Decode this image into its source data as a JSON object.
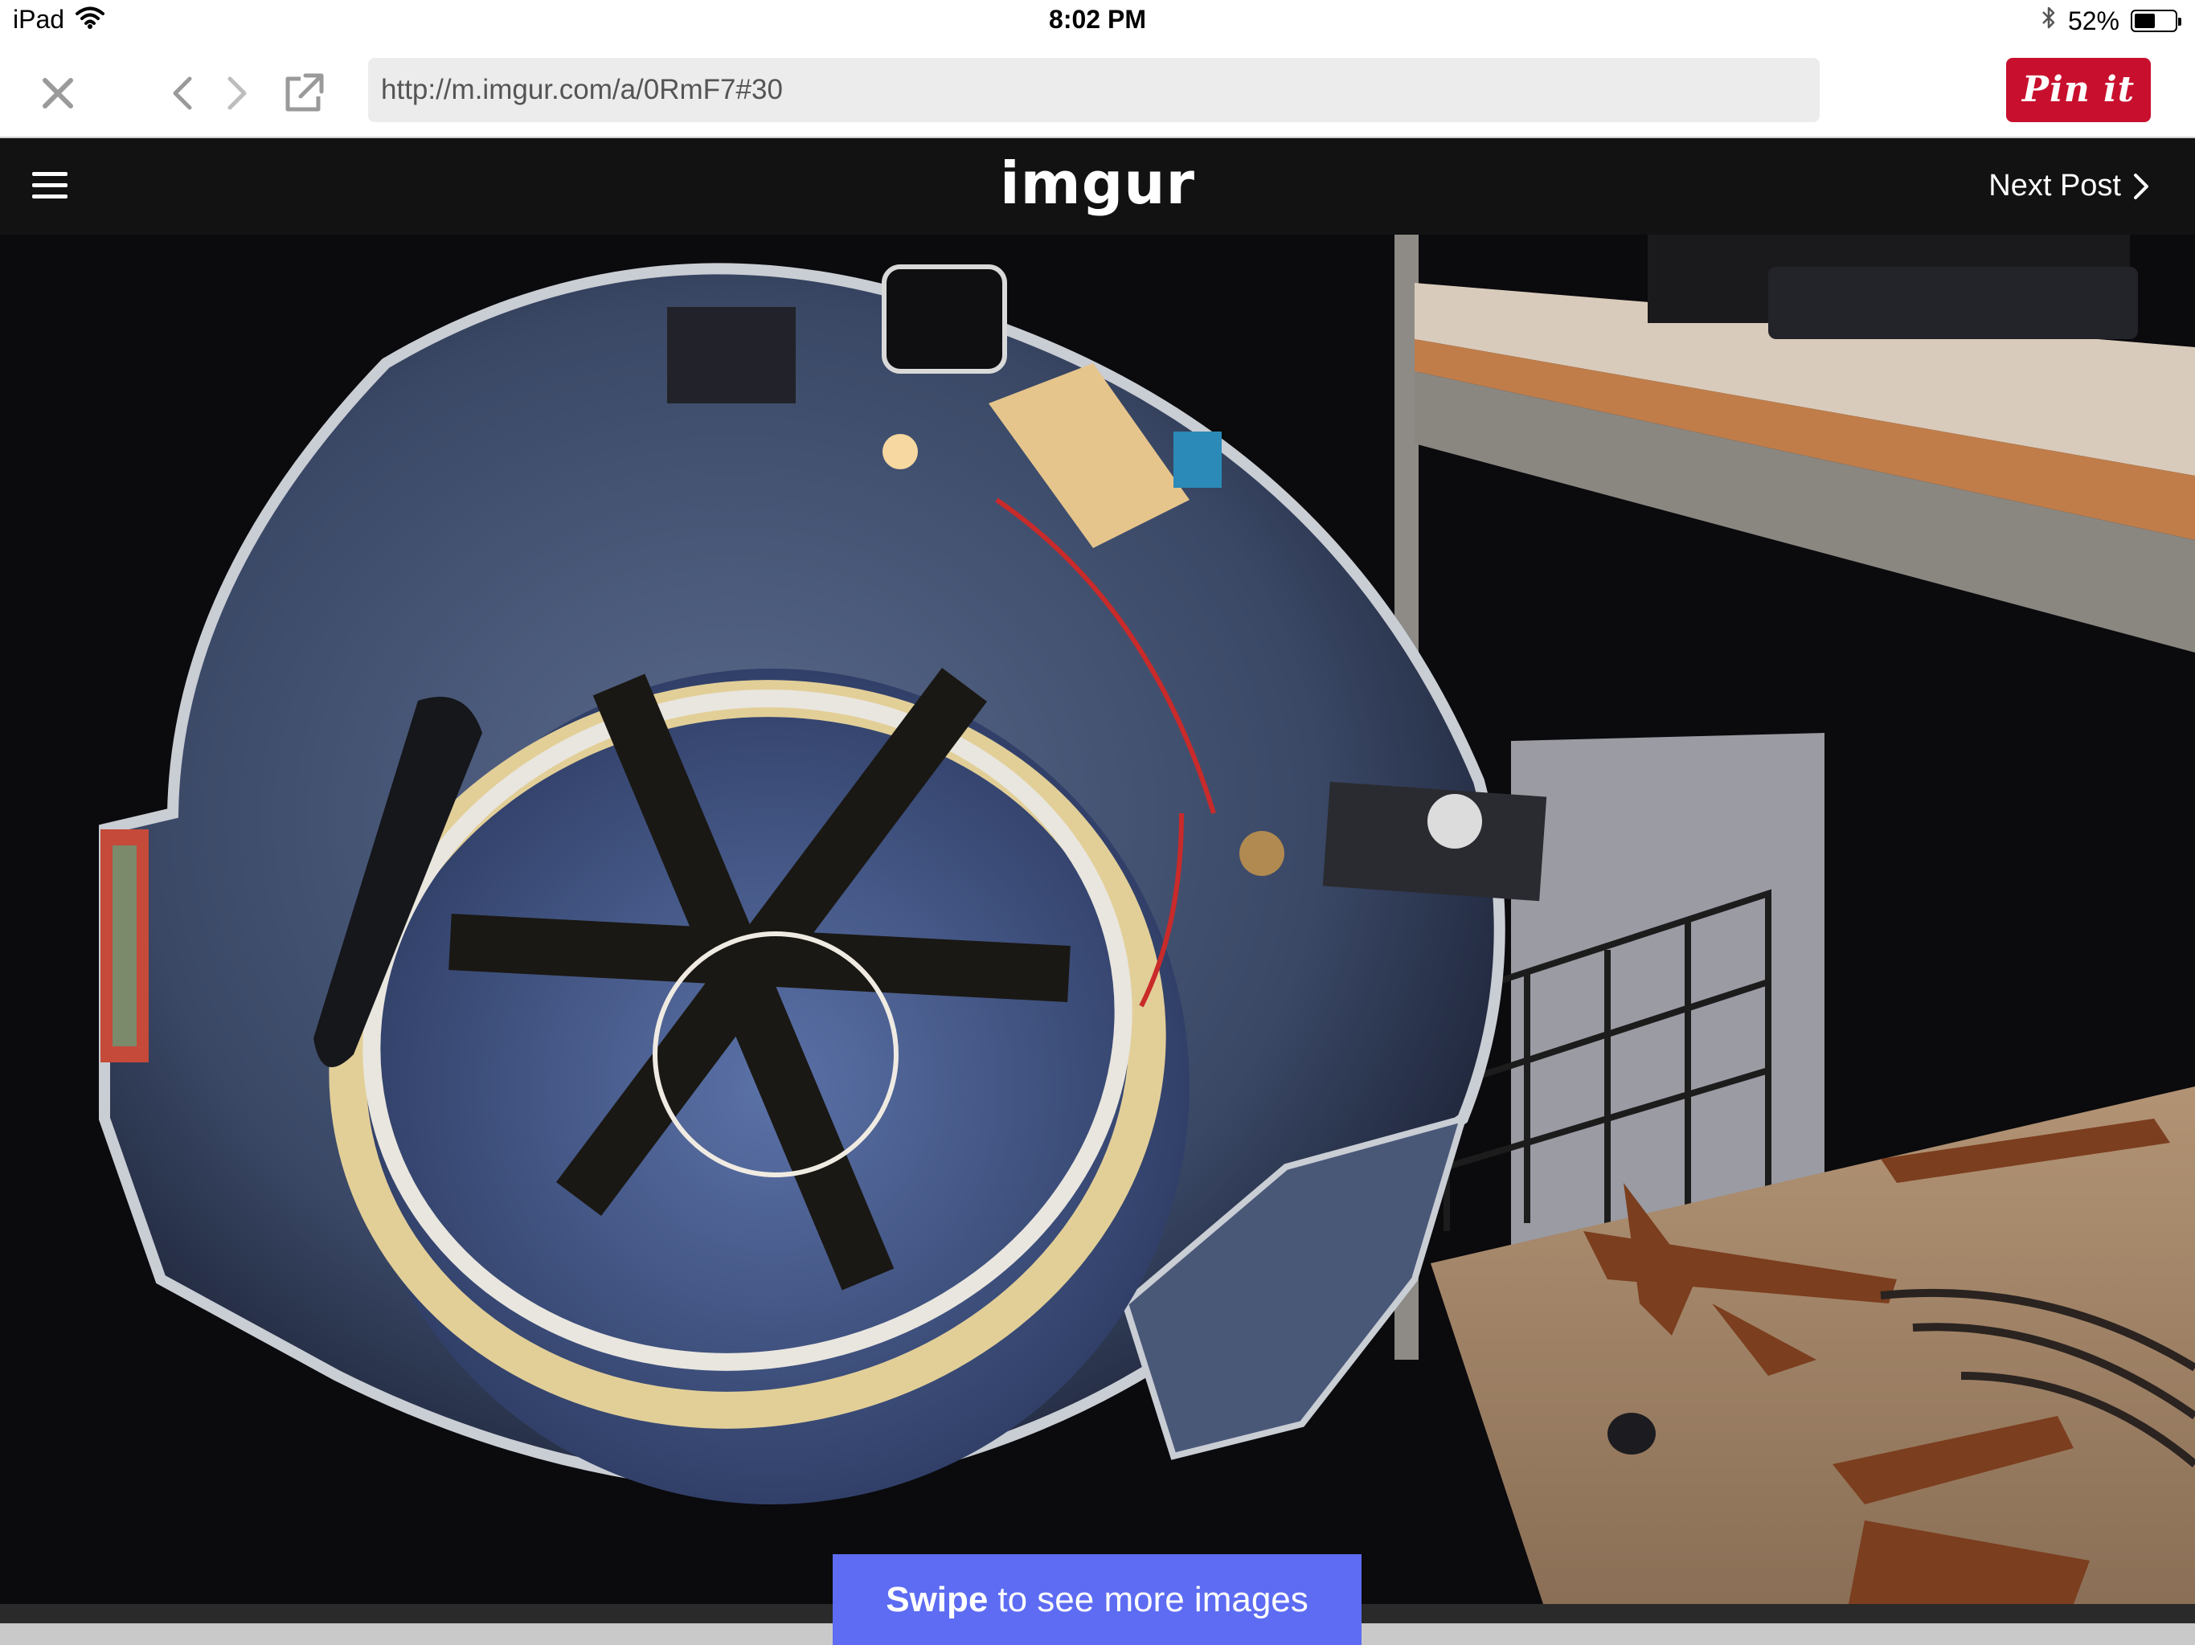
{
  "status_bar": {
    "device": "iPad",
    "time": "8:02 PM",
    "battery": "52%",
    "battery_level": 0.52,
    "icons": [
      "wifi-icon",
      "bluetooth-icon",
      "battery-icon"
    ]
  },
  "browser": {
    "url": "http://m.imgur.com/a/0RmF7#30",
    "pin_label": "Pin it",
    "icons": [
      "close-icon",
      "back-icon",
      "forward-icon",
      "share-icon"
    ],
    "colors": {
      "pin": "#c8102e",
      "url_bg": "#ececec"
    }
  },
  "header": {
    "logo": "imgur",
    "next_post": "Next Post",
    "icons": [
      "hamburger-menu-icon",
      "chevron-right-icon"
    ],
    "colors": {
      "bg": "#121212",
      "logo_dot": "#85bf25"
    }
  },
  "image": {
    "subject": "helmet-interior-photo"
  },
  "banner": {
    "strong": "Swipe",
    "rest": "to see more images",
    "color": "#5d6cf2"
  }
}
